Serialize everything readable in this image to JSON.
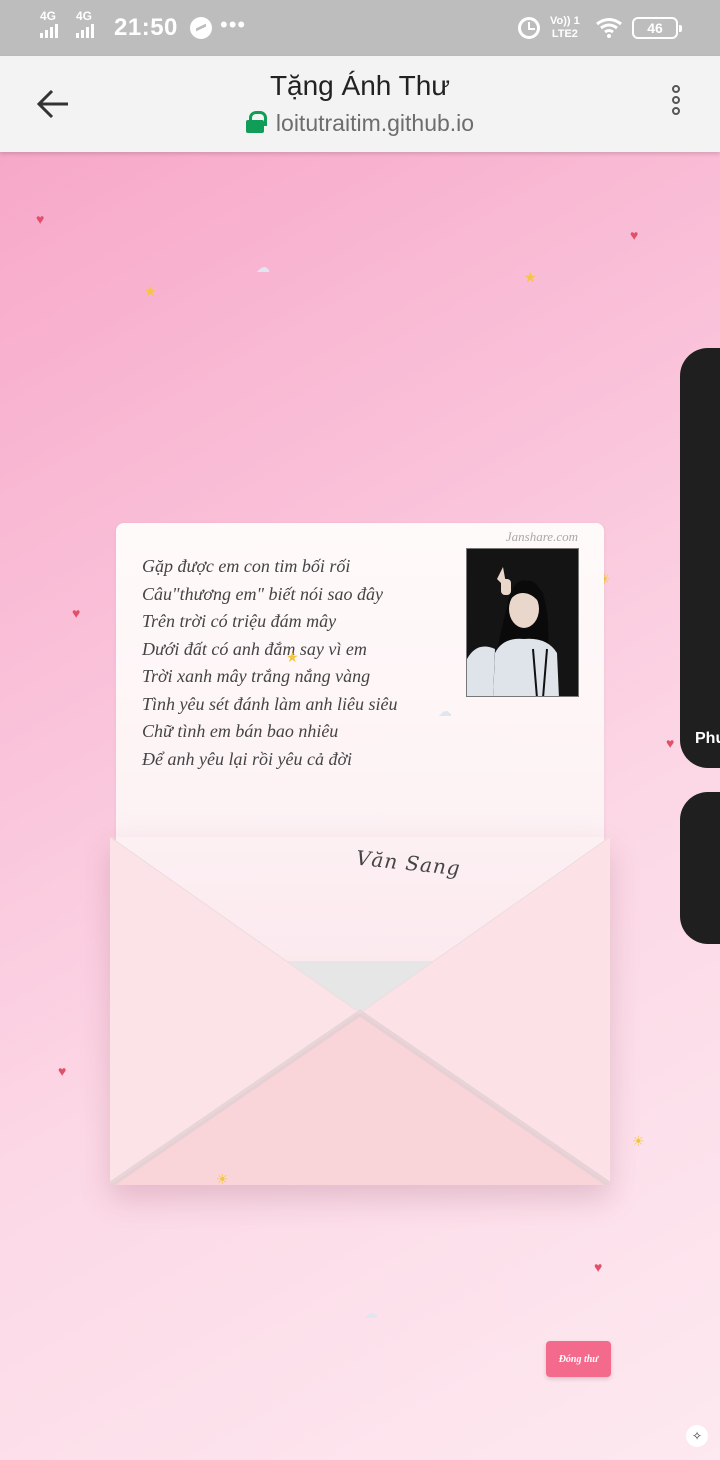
{
  "status_bar": {
    "net1": "4G",
    "net2": "4G",
    "time": "21:50",
    "volte_top": "Vo)) 1",
    "volte_bottom": "LTE2",
    "battery": "46"
  },
  "browser": {
    "title": "Tặng Ánh Thư",
    "url": "loitutraitim.github.io"
  },
  "letter": {
    "watermark": "Janshare.com",
    "poem": [
      "Gặp được em con tim bối rối",
      "Câu\"thương em\" biết nói sao đây",
      "Trên trời có triệu đám mây",
      "Dưới đất có anh đắm say vì em",
      "Trời xanh mây trắng nắng vàng",
      "Tình yêu sét đánh làm anh liêu siêu",
      "Chữ tình em bán bao nhiêu",
      "Để anh yêu lại rồi yêu cả đời"
    ],
    "signature": "Văn Sang"
  },
  "side_card_label": "Phư",
  "close_button": "Đóng thư",
  "colors": {
    "accent": "#f46a8c",
    "envelope_body": "#fde0e4",
    "envelope_flap": "#f9d3d9",
    "lock": "#0f9d58"
  }
}
